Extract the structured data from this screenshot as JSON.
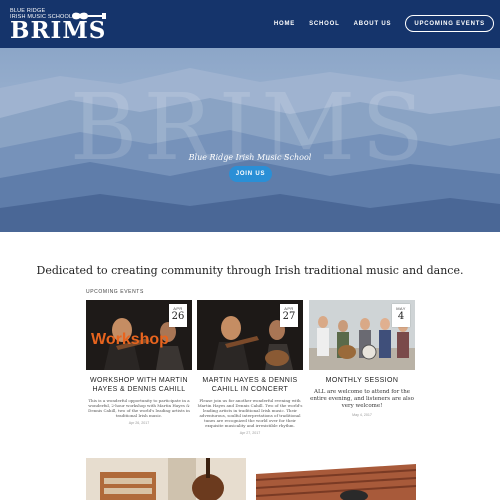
{
  "header": {
    "logo_tagline_1": "BLUE RIDGE",
    "logo_tagline_2": "IRISH MUSIC SCHOOL",
    "logo_wordmark": "BRIMS",
    "nav": [
      "HOME",
      "SCHOOL",
      "ABOUT US"
    ],
    "cta_label": "UPCOMING EVENTS"
  },
  "hero": {
    "watermark": "BRIMS",
    "subtitle": "Blue Ridge Irish Music School",
    "join_label": "JOIN US"
  },
  "main": {
    "tagline": "Dedicated to creating community through Irish traditional music and dance.",
    "section_label": "UPCOMING EVENTS",
    "events": [
      {
        "month": "APR",
        "day": "26",
        "photo_overlay": "Workshop",
        "title": "WORKSHOP WITH MARTIN HAYES & DENNIS CAHILL",
        "description": "This is a wonderful opportunity to participate in a wonderful, 2-hour workshop with Martin Hayes & Dennis Cahill, two of the world's leading artists in traditional Irish music.",
        "date": "Apr 26, 2017"
      },
      {
        "month": "APR",
        "day": "27",
        "title": "MARTIN HAYES & DENNIS CAHILL IN CONCERT",
        "description": "Please join us for another wonderful evening with Martin Hayes and Dennis Cahill. Two of the world's leading artists in traditional Irish music. Their adventurous, soulful interpretations of traditional tunes are recognized the world over for their exquisite musicality and irresistible rhythm.",
        "date": "Apr 27, 2017"
      },
      {
        "month": "MAY",
        "day": "4",
        "title": "MONTHLY SESSION",
        "description": "ALL are welcome to attend for the entire evening, and listeners are also very welcome!",
        "date": "May 4, 2017"
      }
    ]
  },
  "colors": {
    "header_bg": "#15346b",
    "accent_button": "#2a8fd6",
    "workshop_text": "#e8641e"
  }
}
